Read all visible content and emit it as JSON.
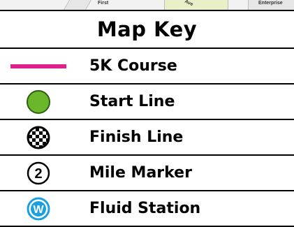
{
  "map": {
    "street_labels": [
      "First",
      "Ave",
      "Enterprise"
    ]
  },
  "legend": {
    "title": "Map Key",
    "items": [
      {
        "label": "5K Course",
        "icon": "pink-course-line-icon",
        "color": "#e0208c"
      },
      {
        "label": "Start Line",
        "icon": "green-circle-icon",
        "color": "#6bb72c"
      },
      {
        "label": "Finish Line",
        "icon": "checkered-flag-circle-icon",
        "color": "#000000"
      },
      {
        "label": "Mile Marker",
        "icon": "mile-marker-icon",
        "marker_text": "2"
      },
      {
        "label": "Fluid Station",
        "icon": "water-station-icon",
        "marker_text": "W",
        "color": "#1aa0e0"
      }
    ]
  }
}
